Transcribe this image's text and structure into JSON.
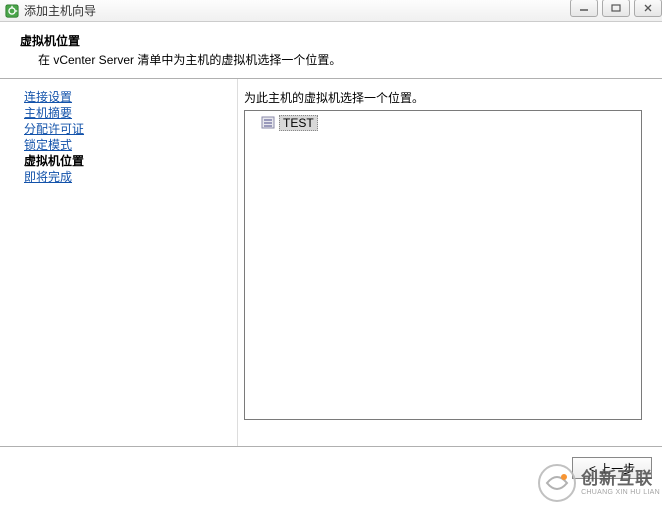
{
  "window": {
    "title": "添加主机向导"
  },
  "header": {
    "title": "虚拟机位置",
    "subtitle": "在 vCenter Server 清单中为主机的虚拟机选择一个位置。"
  },
  "sidebar": {
    "items": [
      {
        "label": "连接设置",
        "active": false
      },
      {
        "label": "主机摘要",
        "active": false
      },
      {
        "label": "分配许可证",
        "active": false
      },
      {
        "label": "锁定模式",
        "active": false
      },
      {
        "label": "虚拟机位置",
        "active": true
      },
      {
        "label": "即将完成",
        "active": false
      }
    ]
  },
  "content": {
    "label": "为此主机的虚拟机选择一个位置。",
    "tree": {
      "items": [
        {
          "label": "TEST",
          "icon": "datacenter-icon",
          "selected": true
        }
      ]
    }
  },
  "footer": {
    "back_label": "< 上一步"
  },
  "watermark": {
    "cn": "创新互联",
    "en": "CHUANG XIN HU LIAN"
  }
}
